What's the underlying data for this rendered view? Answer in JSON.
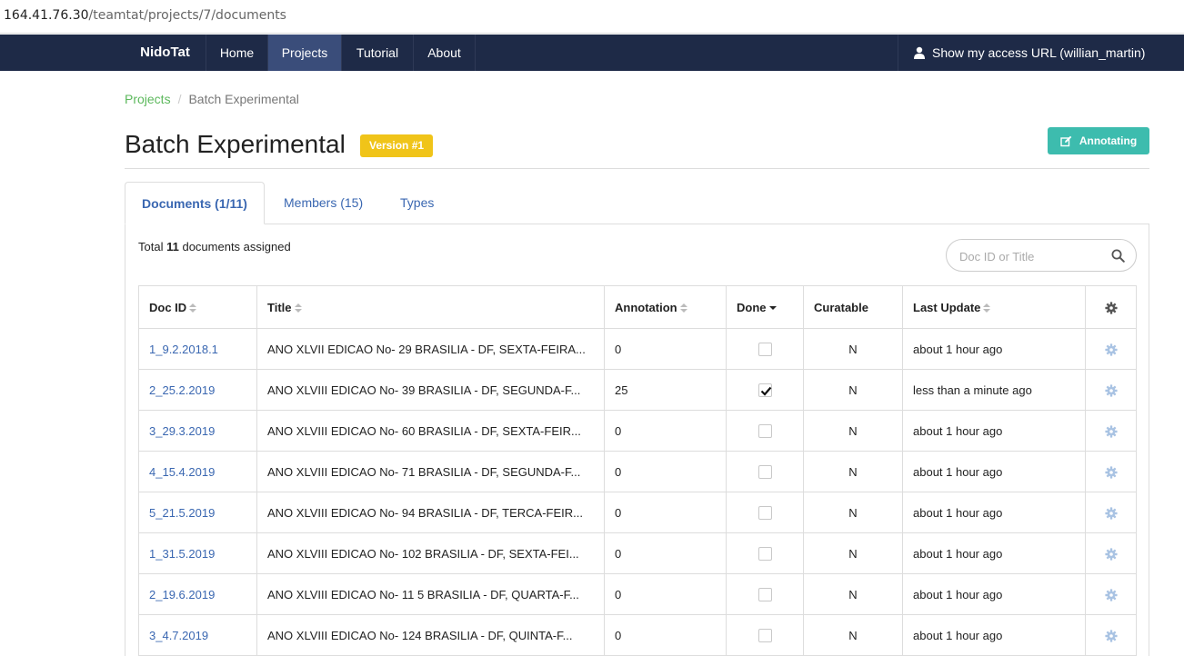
{
  "browser": {
    "url_host": "164.41.76.30",
    "url_path": "/teamtat/projects/7/documents"
  },
  "navbar": {
    "brand": "NidoTat",
    "items": [
      {
        "label": "Home",
        "active": false
      },
      {
        "label": "Projects",
        "active": true
      },
      {
        "label": "Tutorial",
        "active": false
      },
      {
        "label": "About",
        "active": false
      }
    ],
    "user_icon": "user-icon",
    "user_label": "Show my access URL (willian_martin)"
  },
  "breadcrumb": {
    "link": "Projects",
    "current": "Batch Experimental"
  },
  "header": {
    "title": "Batch Experimental",
    "version_badge": "Version #1",
    "annotating_button": "Annotating",
    "annotating_icon": "edit-icon"
  },
  "tabs": [
    {
      "label": "Documents (1/11)",
      "active": true
    },
    {
      "label": "Members (15)",
      "active": false
    },
    {
      "label": "Types",
      "active": false
    }
  ],
  "summary": {
    "prefix": "Total",
    "count": "11",
    "suffix": "documents assigned"
  },
  "search": {
    "placeholder": "Doc ID or Title",
    "value": "",
    "icon": "search-icon"
  },
  "table": {
    "columns": [
      {
        "label": "Doc ID",
        "sort": "sortable"
      },
      {
        "label": "Title",
        "sort": "sortable"
      },
      {
        "label": "Annotation",
        "sort": "sortable"
      },
      {
        "label": "Done",
        "sort": "desc"
      },
      {
        "label": "Curatable",
        "sort": "none"
      },
      {
        "label": "Last Update",
        "sort": "sortable"
      },
      {
        "label": "",
        "sort": "settings",
        "icon": "gear-icon"
      }
    ],
    "rows": [
      {
        "doc_id": "1_9.2.2018.1",
        "title": "ANO XLVII EDICAO No- 29 BRASILIA - DF, SEXTA-FEIRA...",
        "annotation": "0",
        "done": false,
        "curatable": "N",
        "last_update": "about 1 hour ago"
      },
      {
        "doc_id": "2_25.2.2019",
        "title": "ANO XLVIII EDICAO No- 39 BRASILIA - DF, SEGUNDA-F...",
        "annotation": "25",
        "done": true,
        "curatable": "N",
        "last_update": "less than a minute ago"
      },
      {
        "doc_id": "3_29.3.2019",
        "title": "ANO XLVIII EDICAO No- 60 BRASILIA - DF, SEXTA-FEIR...",
        "annotation": "0",
        "done": false,
        "curatable": "N",
        "last_update": "about 1 hour ago"
      },
      {
        "doc_id": "4_15.4.2019",
        "title": "ANO XLVIII EDICAO No- 71 BRASILIA - DF, SEGUNDA-F...",
        "annotation": "0",
        "done": false,
        "curatable": "N",
        "last_update": "about 1 hour ago"
      },
      {
        "doc_id": "5_21.5.2019",
        "title": "ANO XLVIII EDICAO No- 94 BRASILIA - DF, TERCA-FEIR...",
        "annotation": "0",
        "done": false,
        "curatable": "N",
        "last_update": "about 1 hour ago"
      },
      {
        "doc_id": "1_31.5.2019",
        "title": "ANO XLVIII EDICAO No- 102 BRASILIA - DF, SEXTA-FEI...",
        "annotation": "0",
        "done": false,
        "curatable": "N",
        "last_update": "about 1 hour ago"
      },
      {
        "doc_id": "2_19.6.2019",
        "title": "ANO XLVIII EDICAO No- 11 5 BRASILIA - DF, QUARTA-F...",
        "annotation": "0",
        "done": false,
        "curatable": "N",
        "last_update": "about 1 hour ago"
      },
      {
        "doc_id": "3_4.7.2019",
        "title": "ANO XLVIII EDICAO No- 124 BRASILIA - DF, QUINTA-F...",
        "annotation": "0",
        "done": false,
        "curatable": "N",
        "last_update": "about 1 hour ago"
      }
    ]
  },
  "colors": {
    "navbar_bg": "#1e2a47",
    "nav_active_bg": "#3a4d7a",
    "link_blue": "#3a67b1",
    "breadcrumb_green": "#5cb85c",
    "badge_yellow": "#f0c419",
    "annotate_teal": "#3dbcae",
    "gear_icon": "#a9c3e3"
  }
}
